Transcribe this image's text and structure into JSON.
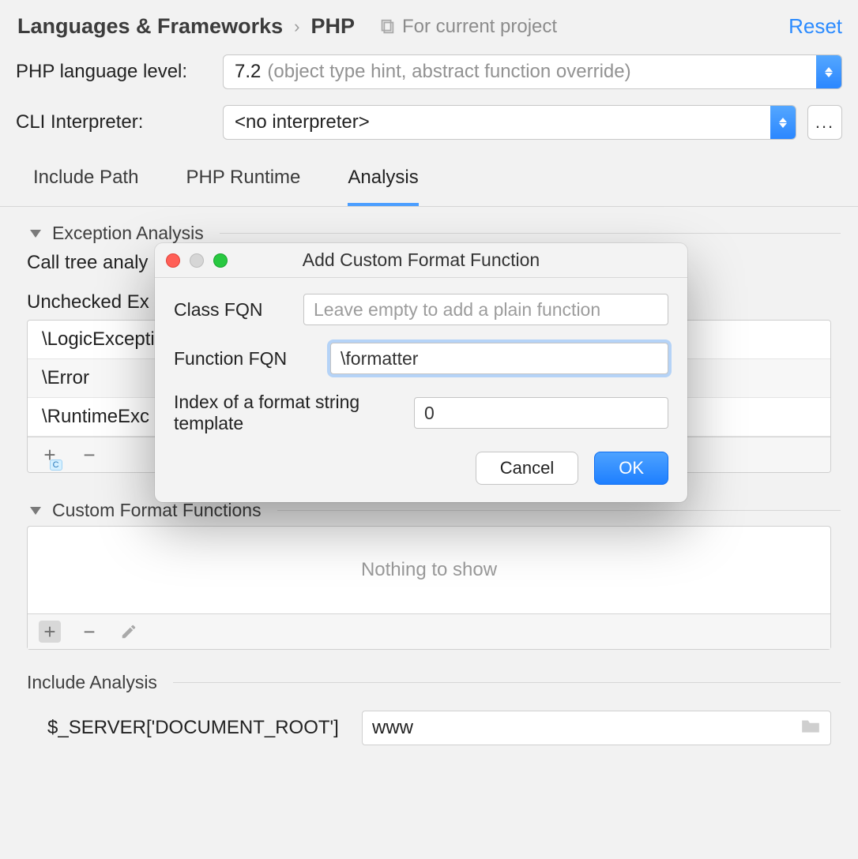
{
  "header": {
    "crumb1": "Languages & Frameworks",
    "separator": "›",
    "crumb2": "PHP",
    "for_project_label": "For current project",
    "reset_label": "Reset"
  },
  "form": {
    "lang_level_label": "PHP language level:",
    "lang_level_value": "7.2",
    "lang_level_hint": "(object type hint, abstract function override)",
    "cli_label": "CLI Interpreter:",
    "cli_value": "<no interpreter>",
    "ellipsis": "..."
  },
  "tabs": {
    "items": [
      "Include Path",
      "PHP Runtime",
      "Analysis"
    ],
    "active_index": 2
  },
  "exception_section": {
    "title": "Exception Analysis",
    "call_tree_line": "Call tree analy",
    "unchecked_label": "Unchecked Ex",
    "rows": [
      "\\LogicException",
      "\\Error",
      "\\RuntimeExc"
    ]
  },
  "custom_section": {
    "title": "Custom Format Functions",
    "empty_text": "Nothing to show"
  },
  "include_section": {
    "title": "Include Analysis",
    "label": "$_SERVER['DOCUMENT_ROOT']",
    "value": "www"
  },
  "modal": {
    "title": "Add Custom Format Function",
    "class_fqn_label": "Class FQN",
    "class_fqn_placeholder": "Leave empty to add a plain function",
    "class_fqn_value": "",
    "function_fqn_label": "Function FQN",
    "function_fqn_value": "\\formatter",
    "index_label": "Index of a format string template",
    "index_value": "0",
    "cancel": "Cancel",
    "ok": "OK"
  },
  "icons": {
    "plus": "+",
    "minus": "−"
  }
}
